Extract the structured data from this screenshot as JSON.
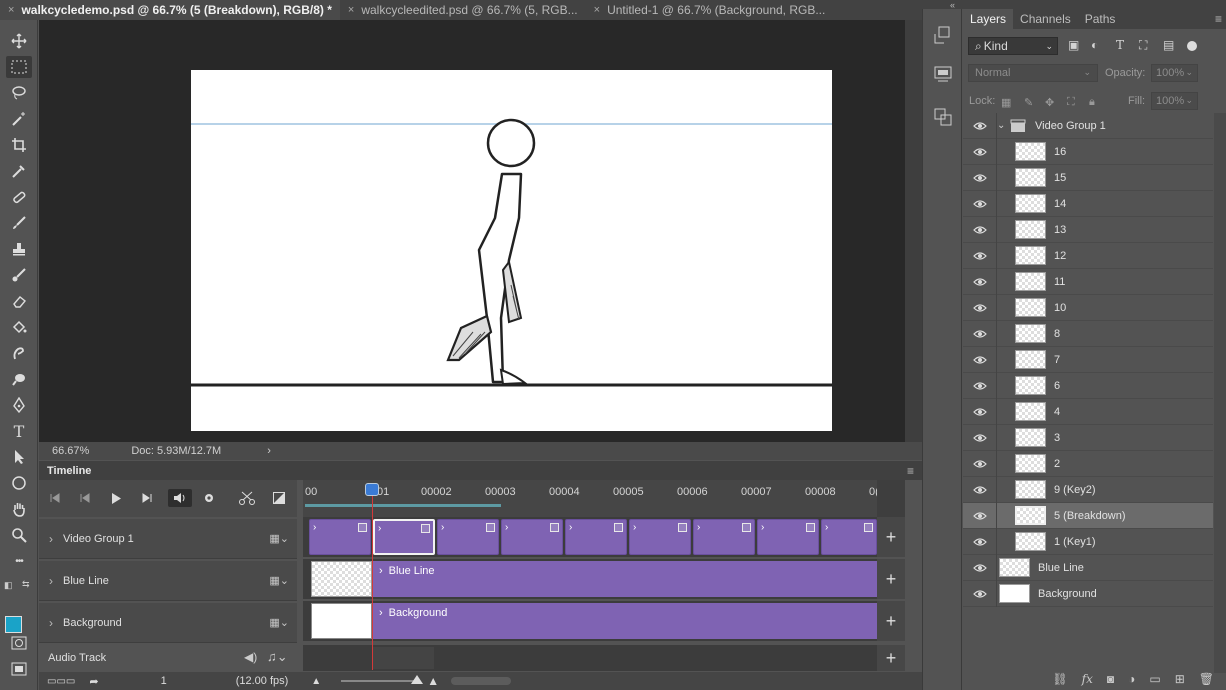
{
  "tabs": [
    {
      "label": "walkcycledemo.psd @ 66.7% (5 (Breakdown), RGB/8) *",
      "active": true
    },
    {
      "label": "walkcycleedited.psd @ 66.7% (5, RGB...",
      "active": false
    },
    {
      "label": "Untitled-1 @ 66.7% (Background, RGB...",
      "active": false
    }
  ],
  "tab_close_glyph": "×",
  "tools": [
    "move-icon",
    "marquee-icon",
    "lasso-icon",
    "magic-wand-icon",
    "crop-icon",
    "eyedropper-icon",
    "healing-brush-icon",
    "brush-icon",
    "clone-stamp-icon",
    "history-brush-icon",
    "eraser-icon",
    "paint-bucket-icon",
    "smudge-icon",
    "dodge-icon",
    "pen-icon",
    "type-icon",
    "path-select-icon",
    "ellipse-icon",
    "hand-icon",
    "zoom-icon",
    "more-icon"
  ],
  "tool_glyphs": {
    "type": "T",
    "more": "•••"
  },
  "colors": {
    "foreground": "#1aa3c8",
    "background": "#ffffff",
    "clip": "#7f63b3",
    "playhead": "#d23a3a"
  },
  "status": {
    "zoom": "66.67%",
    "doc": "Doc: 5.93M/12.7M",
    "arrow": "›"
  },
  "timeline": {
    "title": "Timeline",
    "ruler": [
      "00",
      "01",
      "00002",
      "00003",
      "00004",
      "00005",
      "00006",
      "00007",
      "00008",
      "0("
    ],
    "tracks": [
      {
        "label": "Video Group 1"
      },
      {
        "label": "Blue Line",
        "clip": "Blue Line"
      },
      {
        "label": "Background",
        "clip": "Background"
      }
    ],
    "audio_label": "Audio Track",
    "frame": "1",
    "fps": "(12.00 fps)",
    "add_glyph": "+",
    "chevron": "›"
  },
  "layers_panel": {
    "tabs": [
      "Layers",
      "Channels",
      "Paths"
    ],
    "filter": "Kind",
    "blend_mode": "Normal",
    "opacity_label": "Opacity:",
    "opacity_value": "100%",
    "lock_label": "Lock:",
    "fill_label": "Fill:",
    "fill_value": "100%",
    "group_name": "Video Group 1",
    "layers": [
      "16",
      "15",
      "14",
      "13",
      "12",
      "11",
      "10",
      "8",
      "7",
      "6",
      "4",
      "3",
      "2",
      "9 (Key2)",
      "5 (Breakdown)",
      "1 (Key1)"
    ],
    "selected_layer": "5 (Breakdown)",
    "bottom_layers": [
      "Blue Line",
      "Background"
    ],
    "footer_icons": [
      "link-icon",
      "fx-icon",
      "mask-icon",
      "adjustment-icon",
      "folder-icon",
      "new-layer-icon",
      "trash-icon"
    ],
    "footer_glyphs": {
      "fx": "fx"
    }
  }
}
